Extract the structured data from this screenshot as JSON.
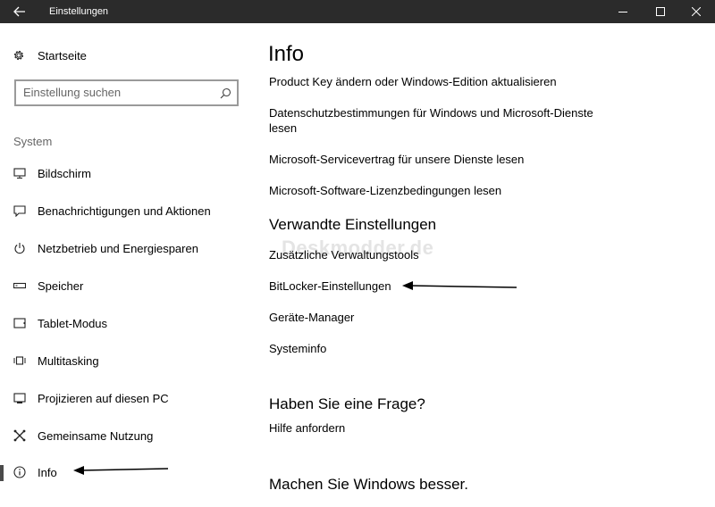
{
  "window": {
    "title": "Einstellungen"
  },
  "nav": {
    "home_label": "Startseite",
    "search_placeholder": "Einstellung suchen",
    "section_label": "System",
    "items": [
      {
        "label": "Bildschirm",
        "icon": "monitor-icon"
      },
      {
        "label": "Benachrichtigungen und Aktionen",
        "icon": "notification-icon"
      },
      {
        "label": "Netzbetrieb und Energiesparen",
        "icon": "power-icon"
      },
      {
        "label": "Speicher",
        "icon": "storage-icon"
      },
      {
        "label": "Tablet-Modus",
        "icon": "tablet-icon"
      },
      {
        "label": "Multitasking",
        "icon": "multitasking-icon"
      },
      {
        "label": "Projizieren auf diesen PC",
        "icon": "project-icon"
      },
      {
        "label": "Gemeinsame Nutzung",
        "icon": "shared-icon"
      },
      {
        "label": "Info",
        "icon": "info-icon",
        "active": true
      }
    ]
  },
  "main": {
    "title": "Info",
    "links": [
      "Product Key ändern oder Windows-Edition aktualisieren",
      "Datenschutzbestimmungen für Windows und Microsoft-Dienste lesen",
      "Microsoft-Servicevertrag für unsere Dienste lesen",
      "Microsoft-Software-Lizenzbedingungen lesen"
    ],
    "related_heading": "Verwandte Einstellungen",
    "related_links": [
      "Zusätzliche Verwaltungstools",
      "BitLocker-Einstellungen",
      "Geräte-Manager",
      "Systeminfo"
    ],
    "question_heading": "Haben Sie eine Frage?",
    "help_link": "Hilfe anfordern",
    "improve_heading": "Machen Sie Windows besser.",
    "watermark": "Deskmodder.de"
  }
}
